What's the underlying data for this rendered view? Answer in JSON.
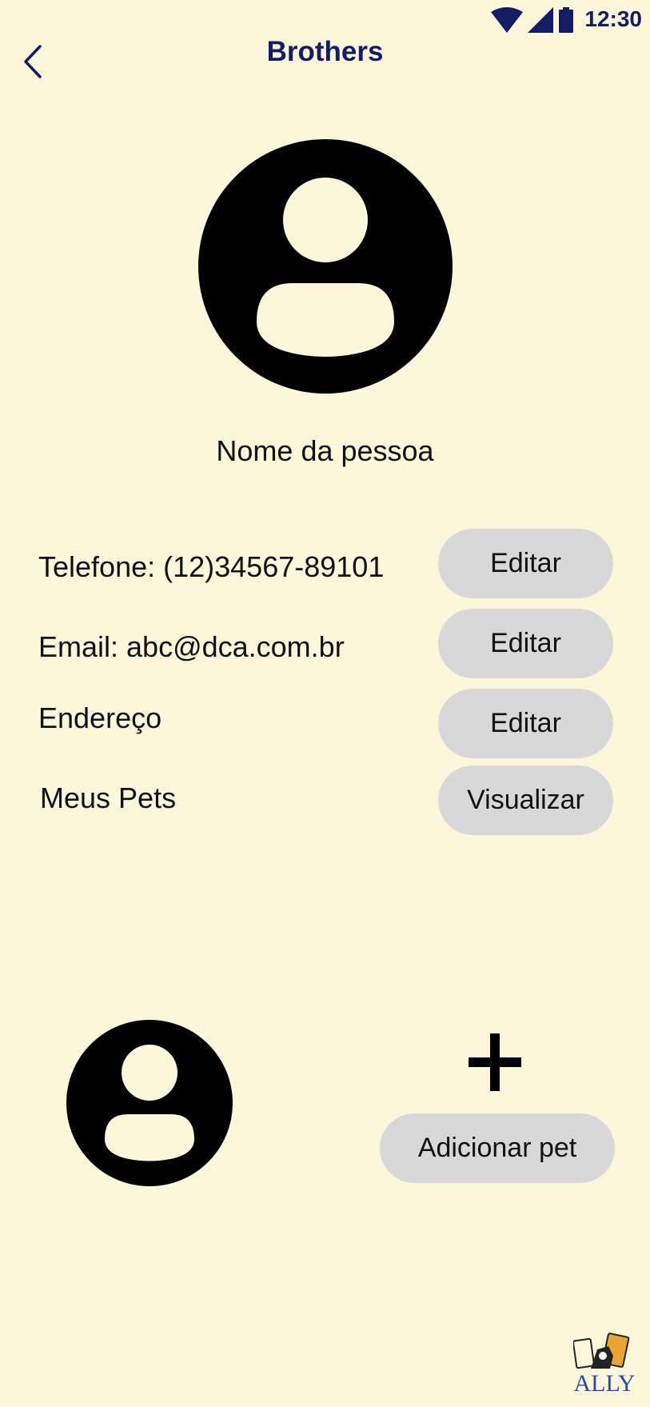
{
  "status_bar": {
    "time": "12:30",
    "icons": [
      "wifi-icon",
      "cellular-signal-icon",
      "battery-icon"
    ]
  },
  "header": {
    "title": "Brothers",
    "back_icon": "chevron-left-icon"
  },
  "profile": {
    "name": "Nome da pessoa",
    "avatar_icon": "user-avatar-icon"
  },
  "fields": [
    {
      "label": "Telefone: (12)34567-89101",
      "button": "Editar"
    },
    {
      "label": "Email: abc@dca.com.br",
      "button": "Editar"
    },
    {
      "label": "Endereço",
      "button": "Editar"
    },
    {
      "label": "Meus Pets",
      "button": "Visualizar"
    }
  ],
  "pets": {
    "avatar_icon": "pet-avatar-icon",
    "add_icon": "plus-icon",
    "add_label": "Adicionar pet"
  },
  "brand": {
    "logo_text": "ALLY"
  },
  "colors": {
    "background": "#fcf6da",
    "accent": "#121d63",
    "button": "#d8d8d8"
  }
}
